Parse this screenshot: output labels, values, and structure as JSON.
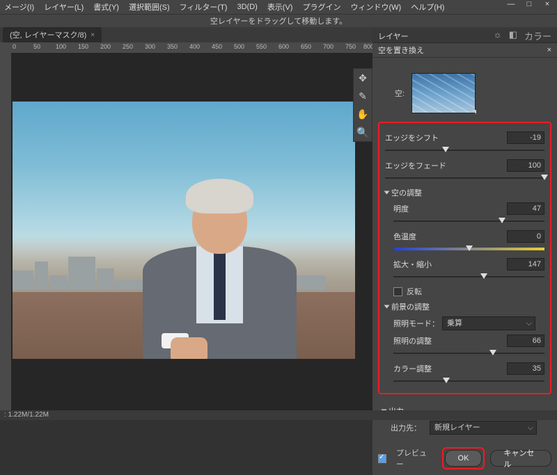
{
  "menu": {
    "items": [
      "メージ(I)",
      "レイヤー(L)",
      "書式(Y)",
      "選択範囲(S)",
      "フィルター(T)",
      "3D(D)",
      "表示(V)",
      "プラグイン",
      "ウィンドウ(W)",
      "ヘルプ(H)"
    ]
  },
  "window_controls": {
    "min": "—",
    "max": "□",
    "close": "×"
  },
  "infobar": "空レイヤーをドラッグして移動します。",
  "tab": {
    "label": "(空, レイヤーマスク/8)",
    "close": "×"
  },
  "ruler": {
    "marks": [
      "0",
      "50",
      "100",
      "150",
      "200",
      "250",
      "300",
      "350",
      "400",
      "450",
      "500",
      "550",
      "600",
      "650",
      "700",
      "750",
      "800"
    ]
  },
  "panel": {
    "tab": "レイヤー",
    "icons": {
      "sun": "☼",
      "swatch": "◧",
      "label": "カラー"
    }
  },
  "side_tools": {
    "move": "✥",
    "brush": "✎",
    "hand": "✋",
    "zoom": "🔍"
  },
  "dialog": {
    "title": "空を置き換え",
    "close": "×",
    "sky_label": "空:",
    "edge_shift": {
      "label": "エッジをシフト",
      "value": "-19",
      "pos": 38
    },
    "edge_fade": {
      "label": "エッジをフェード",
      "value": "100",
      "pos": 100
    },
    "sky_adj": {
      "title": "空の調整",
      "brightness": {
        "label": "明度",
        "value": "47",
        "pos": 72
      },
      "temperature": {
        "label": "色温度",
        "value": "0",
        "pos": 50
      },
      "scale": {
        "label": "拡大・縮小",
        "value": "147",
        "pos": 60
      },
      "flip": {
        "label": "反転",
        "checked": false
      }
    },
    "fg_adj": {
      "title": "前景の調整",
      "mode": {
        "label": "照明モード：",
        "value": "乗算"
      },
      "light": {
        "label": "照明の調整",
        "value": "66",
        "pos": 66
      },
      "color": {
        "label": "カラー調整",
        "value": "35",
        "pos": 35
      }
    },
    "output": {
      "title": "出力",
      "dest_label": "出力先：",
      "dest_value": "新規レイヤー"
    },
    "preview": {
      "label": "プレビュー",
      "checked": true
    },
    "ok": "OK",
    "cancel": "キャンセル"
  },
  "status": ": 1.22M/1.22M"
}
